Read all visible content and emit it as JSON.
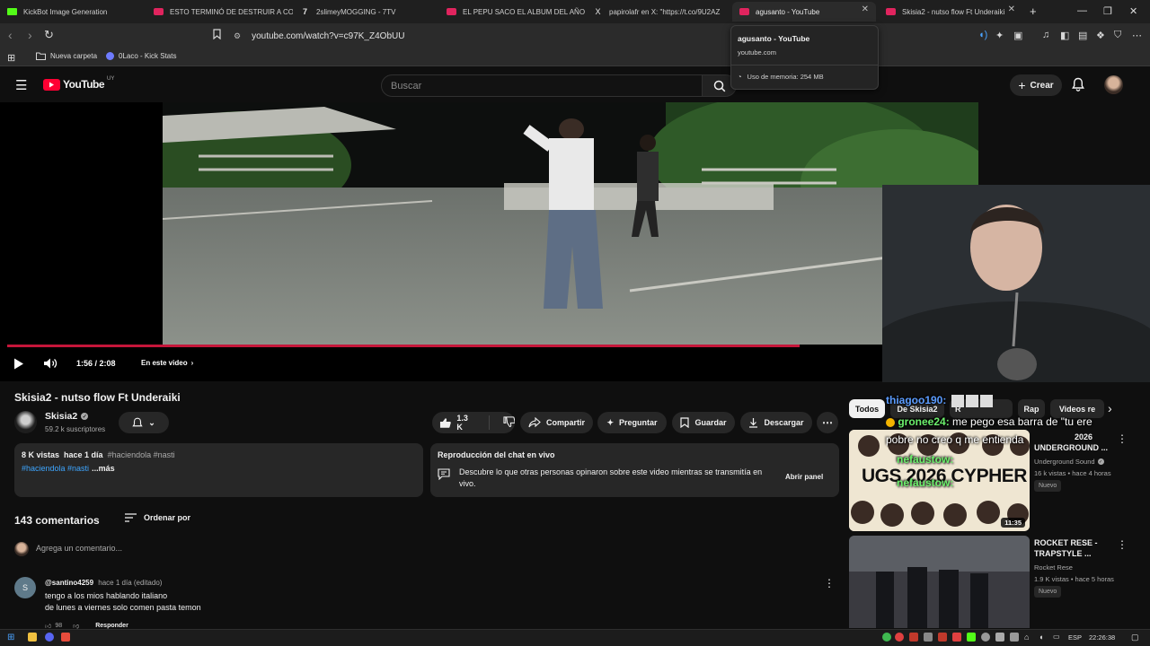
{
  "browser": {
    "tabs": [
      {
        "title": "KickBot Image Generation",
        "icon": "kick-icon"
      },
      {
        "title": "ESTO TERMINÓ DE DESTRUIR A COS",
        "icon": "youtube-icon"
      },
      {
        "title": "2slimeyMOGGING - 7TV",
        "icon": "7tv-icon"
      },
      {
        "title": "EL PEPU SACO EL ALBUM DEL AÑO",
        "icon": "youtube-icon"
      },
      {
        "title": "papirolafr en X: \"https://t.co/9U2AZ",
        "icon": "x-icon"
      },
      {
        "title": "agusanto - YouTube",
        "icon": "youtube-icon"
      },
      {
        "title": "Skisia2 - nutso flow Ft Underaiki",
        "icon": "youtube-icon"
      }
    ],
    "url": "youtube.com/watch?v=c97K_Z4ObUU",
    "bookmarks": [
      {
        "label": "Nueva carpeta",
        "icon": "folder-icon"
      },
      {
        "label": "0Laco - Kick Stats",
        "icon": "kickstats-icon"
      }
    ],
    "tab_tooltip": {
      "title": "agusanto - YouTube",
      "domain": "youtube.com",
      "memory": "Uso de memoria: 254 MB"
    }
  },
  "youtube": {
    "logo": "YouTube",
    "region": "UY",
    "search_placeholder": "Buscar",
    "create_label": "Crear"
  },
  "player": {
    "time": "1:56 / 2:08",
    "chapter_label": "En este video",
    "progress": 0.906
  },
  "video": {
    "title": "Skisia2 - nutso flow Ft Underaiki",
    "channel": "Skisia2",
    "subscribers": "59.2 k suscriptores",
    "likes": "1.3 K",
    "actions": [
      "Compartir",
      "Preguntar",
      "Guardar",
      "Descargar"
    ],
    "views": "8 K vistas",
    "date": "hace 1 día",
    "tags_line1": "#haciendola #nasti",
    "tags_line2": "#haciendola #nasti",
    "more": "...más",
    "chat_replay": {
      "title": "Reproducción del chat en vivo",
      "text": "Descubre lo que otras personas opinaron sobre este video mientras se transmitía en vivo.",
      "button": "Abrir panel"
    }
  },
  "comments": {
    "count": "143 comentarios",
    "sort_label": "Ordenar por",
    "add_placeholder": "Agrega un comentario...",
    "items": [
      {
        "avatar_letter": "S",
        "author": "@santino4259",
        "time": "hace 1 día (editado)",
        "line1": "tengo a los mios hablando italiano",
        "line2": "de lunes a viernes solo comen pasta temon",
        "likes": "98",
        "reply": "Responder"
      }
    ]
  },
  "sidebar": {
    "chips": [
      "Todos",
      "De Skisia2",
      "R",
      "Rap",
      "Videos re"
    ],
    "recommendations": [
      {
        "thumb_text": "UGS 2026 CYPHER",
        "duration": "11:35",
        "title_line1": "2026",
        "title_line2": "UNDERGROUND ...",
        "channel": "Underground Sound",
        "meta": "16 k vistas • hace 4 horas",
        "badge": "Nuevo"
      },
      {
        "title_line1": "ROCKET RESE -",
        "title_line2": "TRAPSTYLE ...",
        "channel": "Rocket Rese",
        "meta": "1.9 K vistas • hace 5 horas",
        "badge": "Nuevo"
      }
    ]
  },
  "overlay_chat": [
    {
      "user": "thiagoo190:",
      "text": "",
      "color": "#5b9cff"
    },
    {
      "user": "gronee24:",
      "text": " me pego esa barra de \"tu ere",
      "color": "#6cf06c"
    },
    {
      "user": "",
      "text": "pobre no creo q me entienda",
      "color": "#ffffff"
    },
    {
      "user": "nefaustow:",
      "text": "",
      "color": "#6cf06c"
    },
    {
      "user": "nefaustow:",
      "text": "",
      "color": "#6cf06c"
    }
  ],
  "taskbar": {
    "lang": "ESP",
    "clock": "22:26:38"
  },
  "colors": {
    "accent_red": "#ff0033",
    "progress_red": "#c5163a",
    "bg": "#0f0f0f",
    "surface": "#272727"
  }
}
